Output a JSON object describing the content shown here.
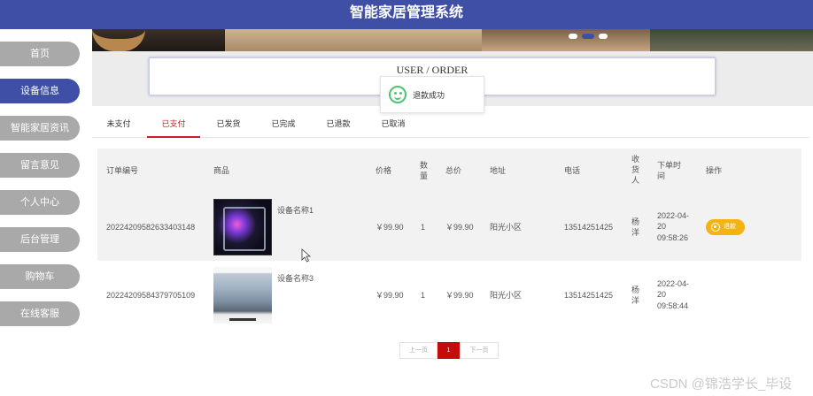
{
  "app": {
    "title": "智能家居管理系统"
  },
  "sidebar": {
    "items": [
      {
        "label": "首页"
      },
      {
        "label": "设备信息"
      },
      {
        "label": "智能家居资讯"
      },
      {
        "label": "留言意见"
      },
      {
        "label": "个人中心"
      },
      {
        "label": "后台管理"
      },
      {
        "label": "购物车"
      },
      {
        "label": "在线客服"
      }
    ],
    "active_index": 1
  },
  "page": {
    "breadcrumb": "USER / ORDER"
  },
  "toast": {
    "message": "退款成功"
  },
  "tabs": {
    "items": [
      "未支付",
      "已支付",
      "已发货",
      "已完成",
      "已退款",
      "已取消"
    ],
    "active_index": 1
  },
  "table": {
    "headers": {
      "order_no": "订单编号",
      "product": "商品",
      "price": "价格",
      "qty": "数量",
      "total": "总价",
      "address": "地址",
      "phone": "电话",
      "receiver": "收货人",
      "time": "下单时间",
      "action": "操作"
    },
    "rows": [
      {
        "order_no": "20224209582633403148",
        "product": "设备名称1",
        "price": "￥99.90",
        "qty": "1",
        "total": "￥99.90",
        "address": "阳光小区",
        "phone": "13514251425",
        "receiver": "杨洋",
        "time_date": "2022-04-20",
        "time_clock": "09:58:26",
        "action": "退款"
      },
      {
        "order_no": "20224209584379705109",
        "product": "设备名称3",
        "price": "￥99.90",
        "qty": "1",
        "total": "￥99.90",
        "address": "阳光小区",
        "phone": "13514251425",
        "receiver": "杨洋",
        "time_date": "2022-04-20",
        "time_clock": "09:58:44",
        "action": ""
      }
    ]
  },
  "pagination": {
    "prev": "上一页",
    "current": "1",
    "next": "下一页"
  },
  "watermark": "CSDN @锦浩学长_毕设",
  "colors": {
    "primary": "#3f4fa6",
    "sidebar_inactive": "#a9a9a9",
    "tab_active": "#c91f2c",
    "refund_button": "#f3b312",
    "page_active": "#c40c0c"
  }
}
